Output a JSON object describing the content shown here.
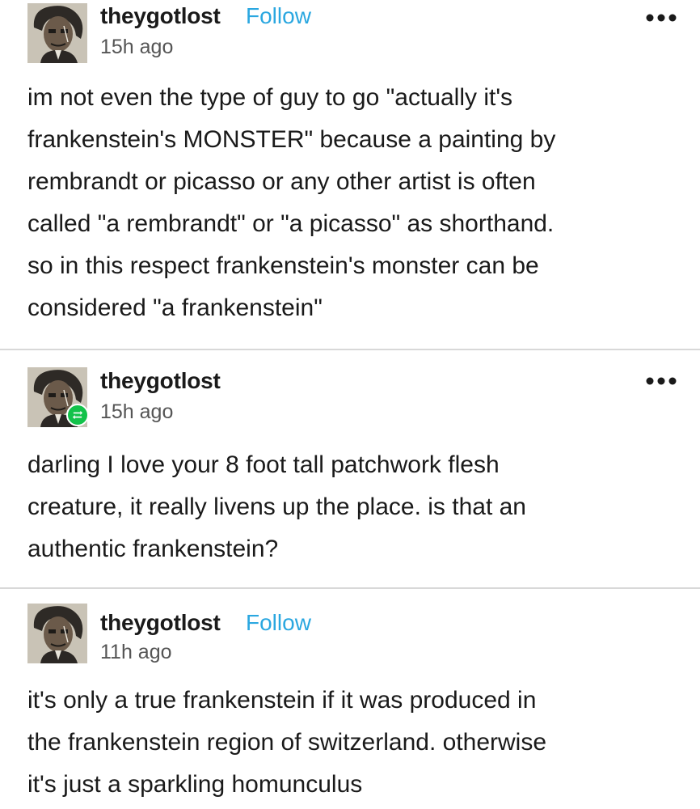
{
  "posts": [
    {
      "username": "theygotlost",
      "follow_label": "Follow",
      "timestamp": "15h ago",
      "more_icon": "more-options-icon",
      "body": "im not even the type of guy to go \"actually it's\nfrankenstein's MONSTER\" because a painting by\nrembrandt or picasso or any other artist is often\ncalled \"a rembrandt\" or \"a picasso\" as shorthand.\nso in this respect frankenstein's monster can be\nconsidered \"a frankenstein\""
    },
    {
      "username": "theygotlost",
      "timestamp": "15h ago",
      "badge_icon": "reblog-icon",
      "more_icon": "more-options-icon",
      "body": "darling I love your 8 foot tall patchwork flesh\ncreature, it really livens up the place. is that an\nauthentic frankenstein?"
    },
    {
      "username": "theygotlost",
      "follow_label": "Follow",
      "timestamp": "11h ago",
      "body": "it's only a true frankenstein if it was produced in\nthe frankenstein region of switzerland. otherwise\nit's just a sparkling homunculus"
    }
  ],
  "colors": {
    "follow": "#2aa7e0",
    "reblog_badge": "#13c24a",
    "divider": "#d8d8d8",
    "text": "#1a1a1a",
    "muted": "#555555"
  }
}
